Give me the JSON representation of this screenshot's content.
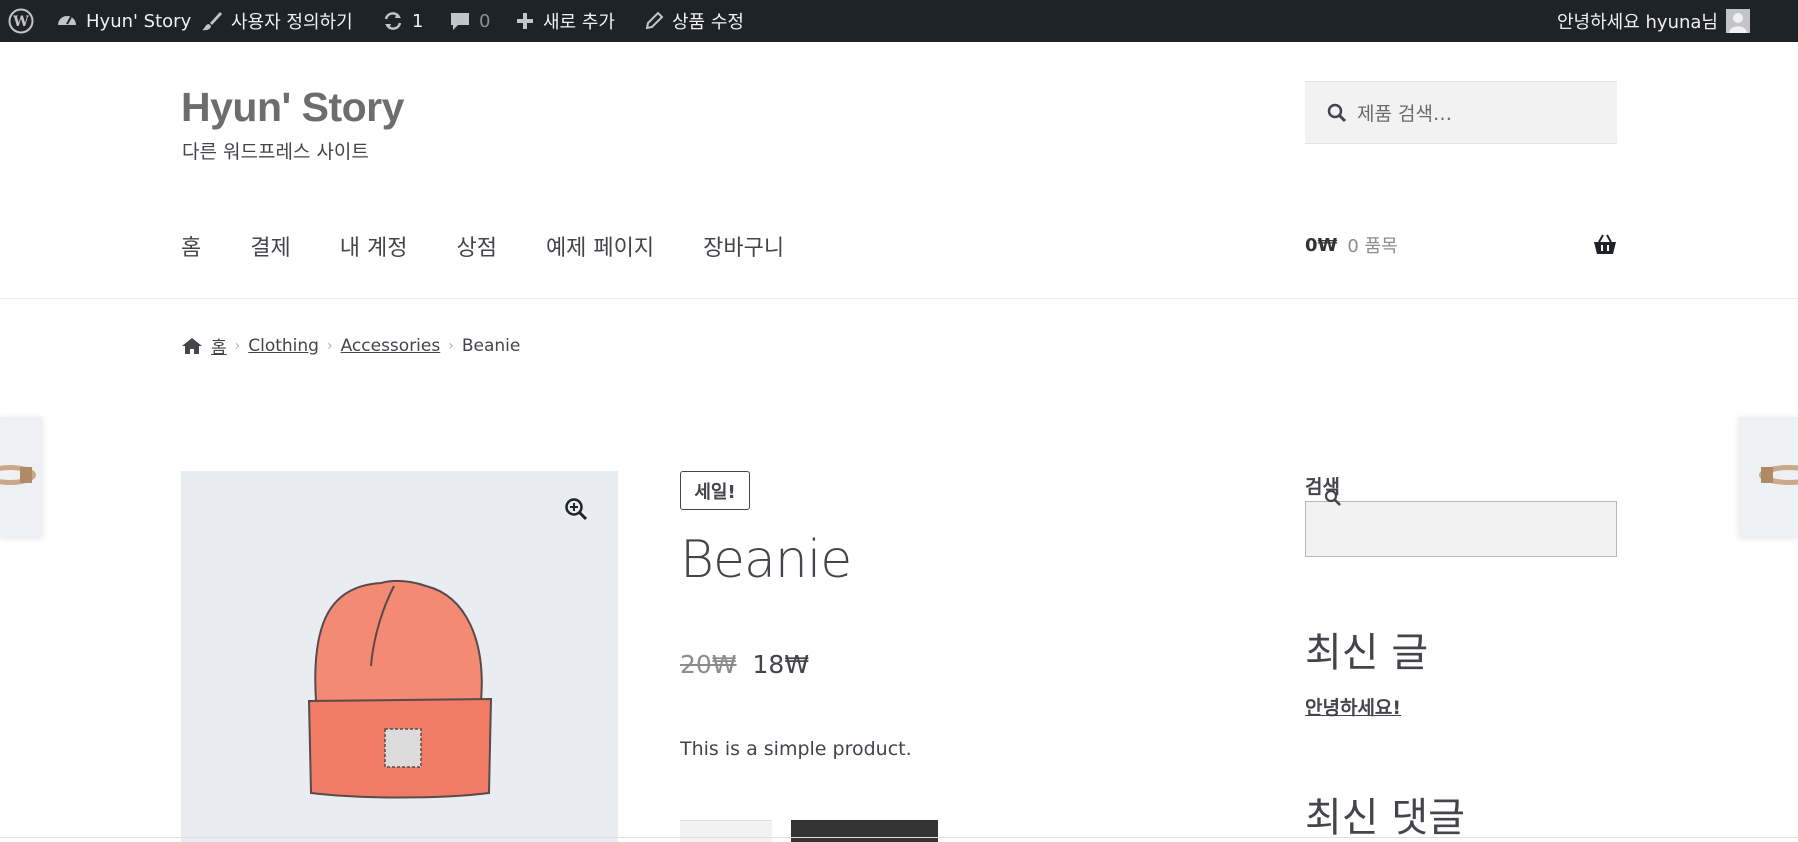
{
  "admin_bar": {
    "site_name": "Hyun' Story",
    "customize": "사용자 정의하기",
    "updates_count": "1",
    "comments_count": "0",
    "new_content": "새로 추가",
    "edit_product": "상품 수정",
    "greeting": "안녕하세요 hyuna님",
    "icons": [
      "wordpress-icon",
      "dashboard-icon",
      "brush-icon",
      "refresh-icon",
      "comment-icon",
      "plus-icon",
      "pencil-icon",
      "avatar"
    ]
  },
  "header": {
    "site_title": "Hyun' Story",
    "site_description": "다른 워드프레스 사이트",
    "search_placeholder": "제품 검색…"
  },
  "nav": {
    "items": [
      "홈",
      "결제",
      "내 계정",
      "상점",
      "예제 페이지",
      "장바구니"
    ]
  },
  "cart": {
    "amount": "0₩",
    "count": "0 품목"
  },
  "breadcrumb": {
    "home": "홈",
    "items": [
      "Clothing",
      "Accessories"
    ],
    "current": "Beanie"
  },
  "product": {
    "sale_badge": "세일!",
    "title": "Beanie",
    "old_price": "20₩",
    "price": "18₩",
    "short_description": "This is a simple product."
  },
  "sidebar": {
    "search_title": "검색",
    "recent_posts_title": "최신 글",
    "recent_post": "안녕하세요!",
    "recent_comments_title": "최신 댓글"
  },
  "colors": {
    "admin_bar_bg": "#1d2327",
    "text": "#43454b",
    "button_bg": "#333333",
    "image_bg": "#e9edf1",
    "beanie": "#f28a74"
  }
}
